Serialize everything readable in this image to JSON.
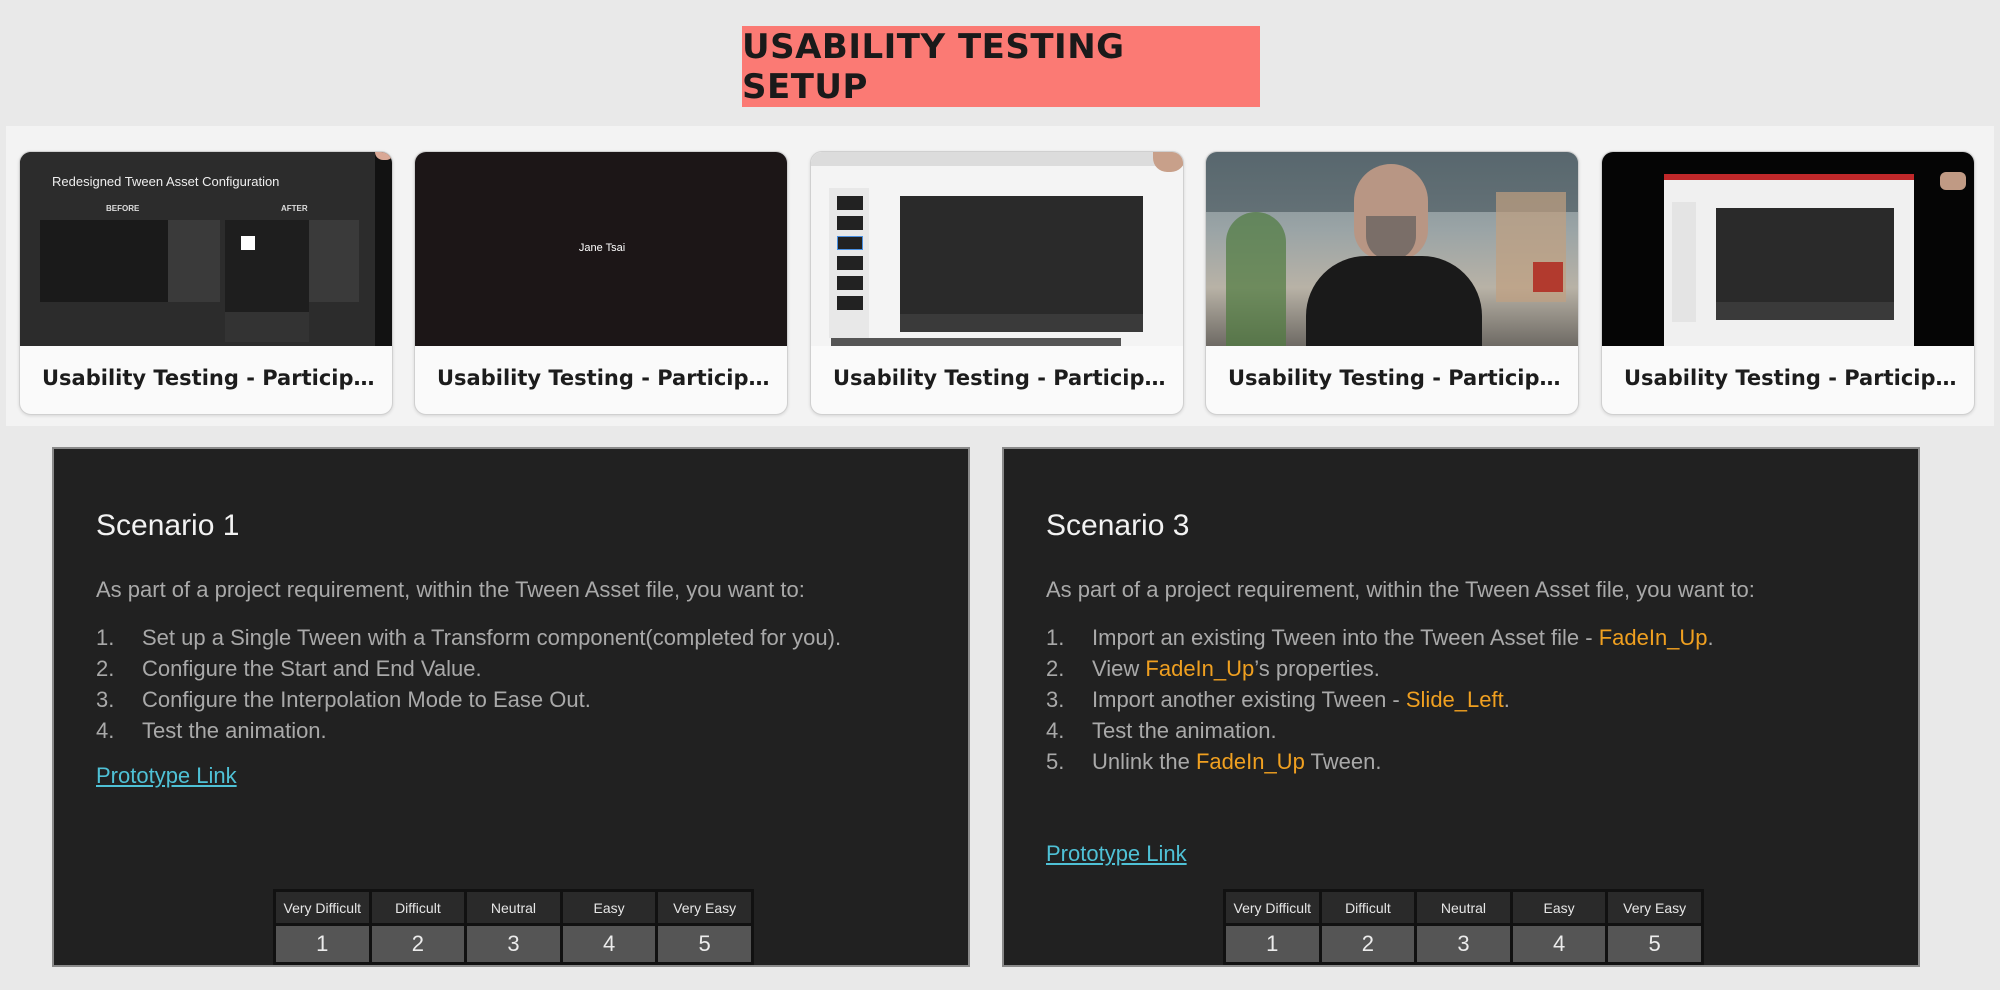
{
  "page": {
    "title": "USABILITY TESTING SETUP"
  },
  "participants": [
    {
      "label": "Usability Testing - Participa...",
      "thumb": {
        "heading": "Redesigned Tween Asset Configuration",
        "before": "BEFORE",
        "after": "AFTER"
      }
    },
    {
      "label": "Usability Testing - Participa...",
      "thumb": {
        "name": "Jane Tsai"
      }
    },
    {
      "label": "Usability Testing - Participa...",
      "thumb": {}
    },
    {
      "label": "Usability Testing - Participa...",
      "thumb": {}
    },
    {
      "label": "Usability Testing - Participa...",
      "thumb": {}
    }
  ],
  "scenarios": [
    {
      "title": "Scenario 1",
      "intro": "As part of a project requirement, within the Tween Asset file, you want to:",
      "steps": [
        "Set up a Single Tween with a Transform component(completed for you).",
        "Configure the Start and End Value.",
        "Configure the Interpolation Mode to Ease Out.",
        "Test the animation."
      ],
      "link": "Prototype Link"
    },
    {
      "title": "Scenario 3",
      "intro": "As part of a project requirement, within the Tween Asset file, you want to:",
      "steps": [
        {
          "pre": "Import an existing Tween into the Tween Asset file - ",
          "hl": "FadeIn_Up",
          "post": "."
        },
        {
          "pre": "View ",
          "hl": "FadeIn_Up",
          "post": "’s properties."
        },
        {
          "pre": "Import another existing Tween - ",
          "hl": "Slide_Left",
          "post": "."
        },
        {
          "pre": "Test the animation.",
          "hl": "",
          "post": ""
        },
        {
          "pre": "Unlink the ",
          "hl": "FadeIn_Up",
          "post": " Tween."
        }
      ],
      "link": "Prototype Link"
    }
  ],
  "rating_scale": [
    {
      "label": "Very Difficult",
      "value": "1"
    },
    {
      "label": "Difficult",
      "value": "2"
    },
    {
      "label": "Neutral",
      "value": "3"
    },
    {
      "label": "Easy",
      "value": "4"
    },
    {
      "label": "Very Easy",
      "value": "5"
    }
  ],
  "colors": {
    "banner": "#fb7a74",
    "panel_bg": "#212121",
    "highlight": "#f0a020",
    "link": "#4fc1d6"
  }
}
